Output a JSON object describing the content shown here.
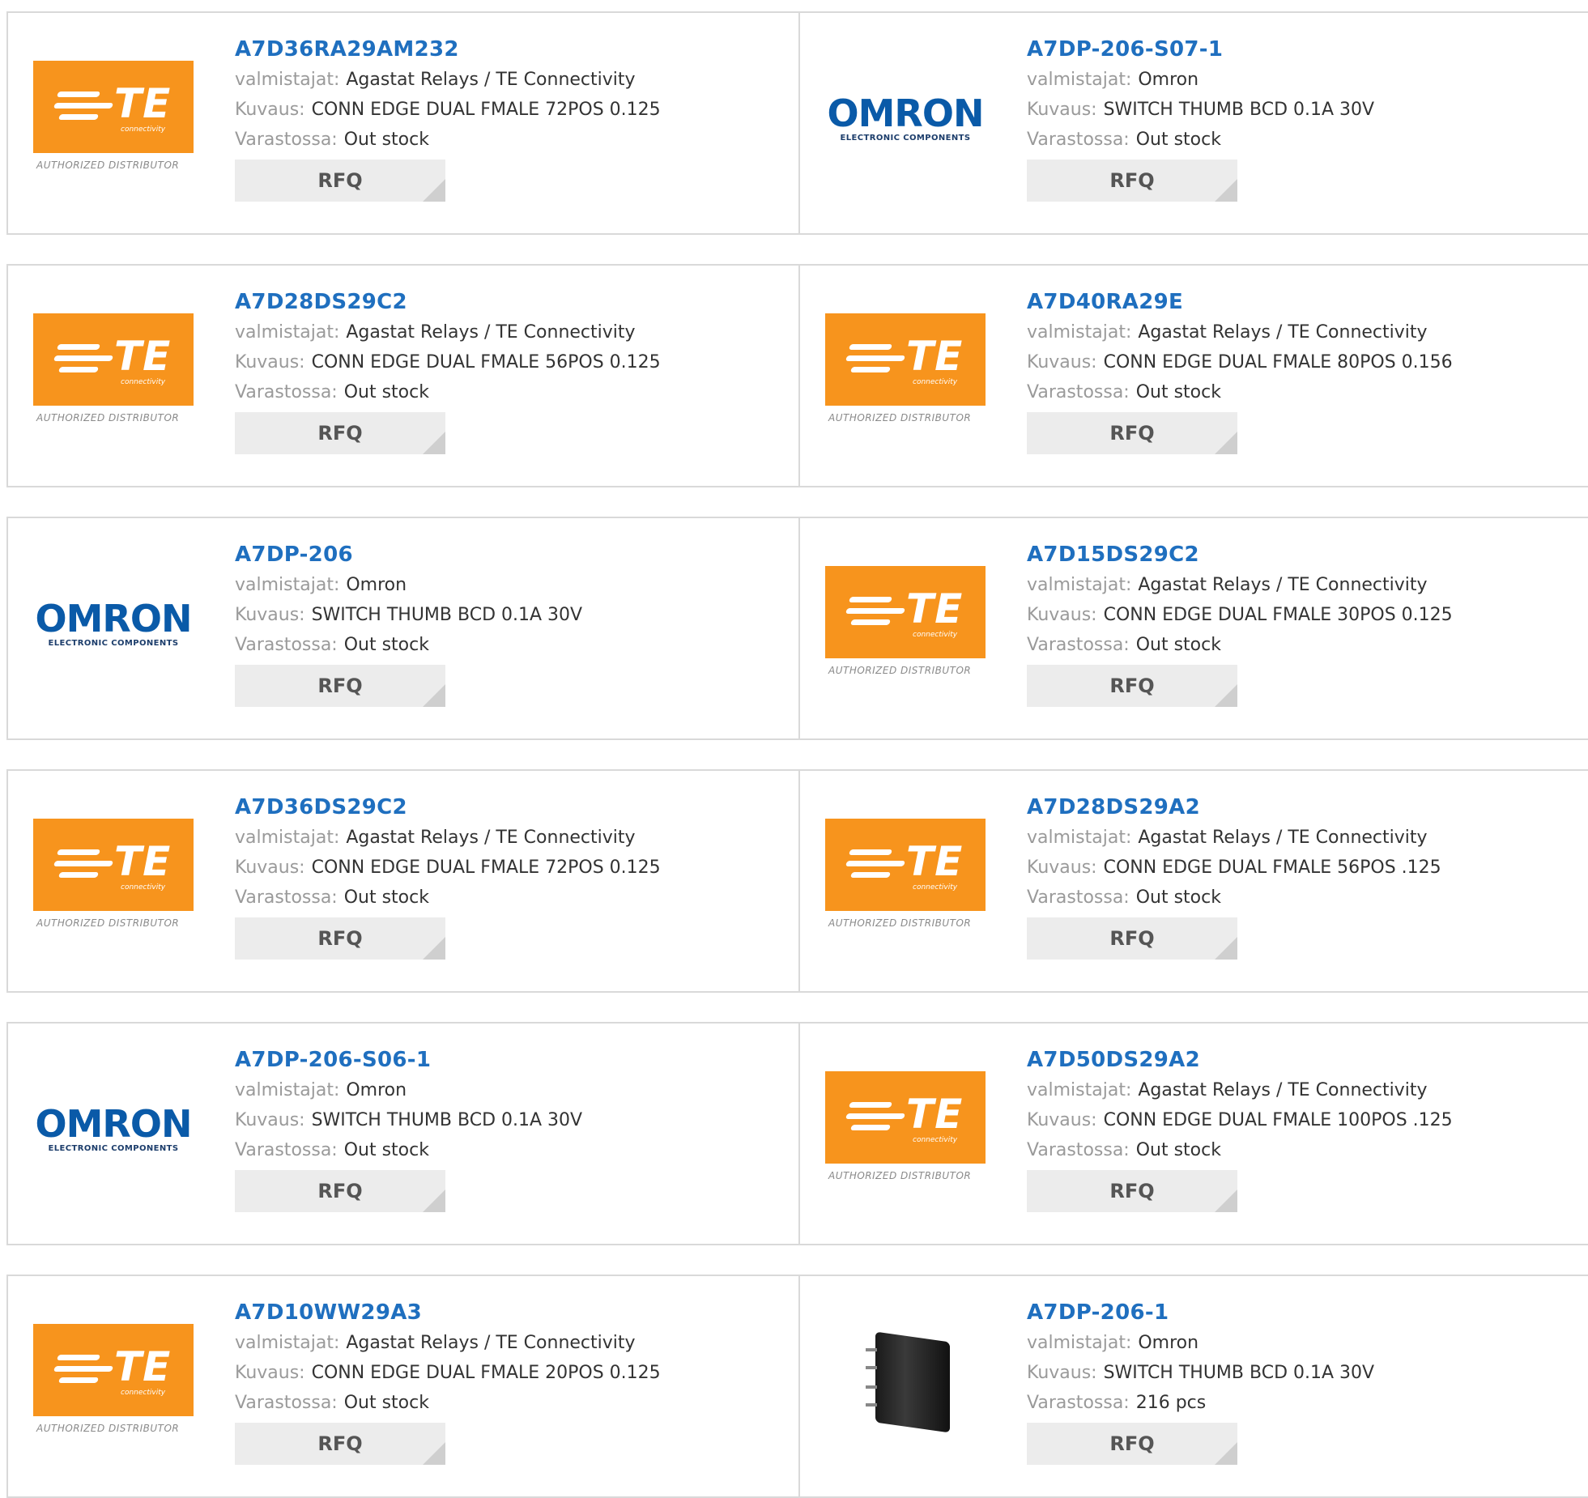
{
  "labels": {
    "manufacturer": "valmistajat:",
    "description": "Kuvaus:",
    "stock": "Varastossa:",
    "rfq": "RFQ"
  },
  "logos": {
    "te": {
      "word": "TE",
      "sub": "connectivity",
      "auth": "AUTHORIZED DISTRIBUTOR",
      "color": "#f7941d"
    },
    "omron": {
      "word": "OMRON",
      "sub": "ELECTRONIC COMPONENTS",
      "color": "#0a5aa8"
    }
  },
  "colors": {
    "title": "#1f6fbf",
    "label": "#9a9a9a",
    "button_bg": "#ececec"
  },
  "products": [
    {
      "part": "A7D36RA29AM232",
      "manufacturer": "Agastat Relays / TE Connectivity",
      "description": "CONN EDGE DUAL FMALE 72POS 0.125",
      "stock": "Out stock",
      "logo": "te"
    },
    {
      "part": "A7DP-206-S07-1",
      "manufacturer": "Omron",
      "description": "SWITCH THUMB BCD 0.1A 30V",
      "stock": "Out stock",
      "logo": "omron"
    },
    {
      "part": "A7D28DS29C2",
      "manufacturer": "Agastat Relays / TE Connectivity",
      "description": "CONN EDGE DUAL FMALE 56POS 0.125",
      "stock": "Out stock",
      "logo": "te"
    },
    {
      "part": "A7D40RA29E",
      "manufacturer": "Agastat Relays / TE Connectivity",
      "description": "CONN EDGE DUAL FMALE 80POS 0.156",
      "stock": "Out stock",
      "logo": "te"
    },
    {
      "part": "A7DP-206",
      "manufacturer": "Omron",
      "description": "SWITCH THUMB BCD 0.1A 30V",
      "stock": "Out stock",
      "logo": "omron"
    },
    {
      "part": "A7D15DS29C2",
      "manufacturer": "Agastat Relays / TE Connectivity",
      "description": "CONN EDGE DUAL FMALE 30POS 0.125",
      "stock": "Out stock",
      "logo": "te"
    },
    {
      "part": "A7D36DS29C2",
      "manufacturer": "Agastat Relays / TE Connectivity",
      "description": "CONN EDGE DUAL FMALE 72POS 0.125",
      "stock": "Out stock",
      "logo": "te"
    },
    {
      "part": "A7D28DS29A2",
      "manufacturer": "Agastat Relays / TE Connectivity",
      "description": "CONN EDGE DUAL FMALE 56POS .125",
      "stock": "Out stock",
      "logo": "te"
    },
    {
      "part": "A7DP-206-S06-1",
      "manufacturer": "Omron",
      "description": "SWITCH THUMB BCD 0.1A 30V",
      "stock": "Out stock",
      "logo": "omron"
    },
    {
      "part": "A7D50DS29A2",
      "manufacturer": "Agastat Relays / TE Connectivity",
      "description": "CONN EDGE DUAL FMALE 100POS .125",
      "stock": "Out stock",
      "logo": "te"
    },
    {
      "part": "A7D10WW29A3",
      "manufacturer": "Agastat Relays / TE Connectivity",
      "description": "CONN EDGE DUAL FMALE 20POS 0.125",
      "stock": "Out stock",
      "logo": "te"
    },
    {
      "part": "A7DP-206-1",
      "manufacturer": "Omron",
      "description": "SWITCH THUMB BCD 0.1A 30V",
      "stock": "216 pcs",
      "logo": "photo"
    }
  ]
}
